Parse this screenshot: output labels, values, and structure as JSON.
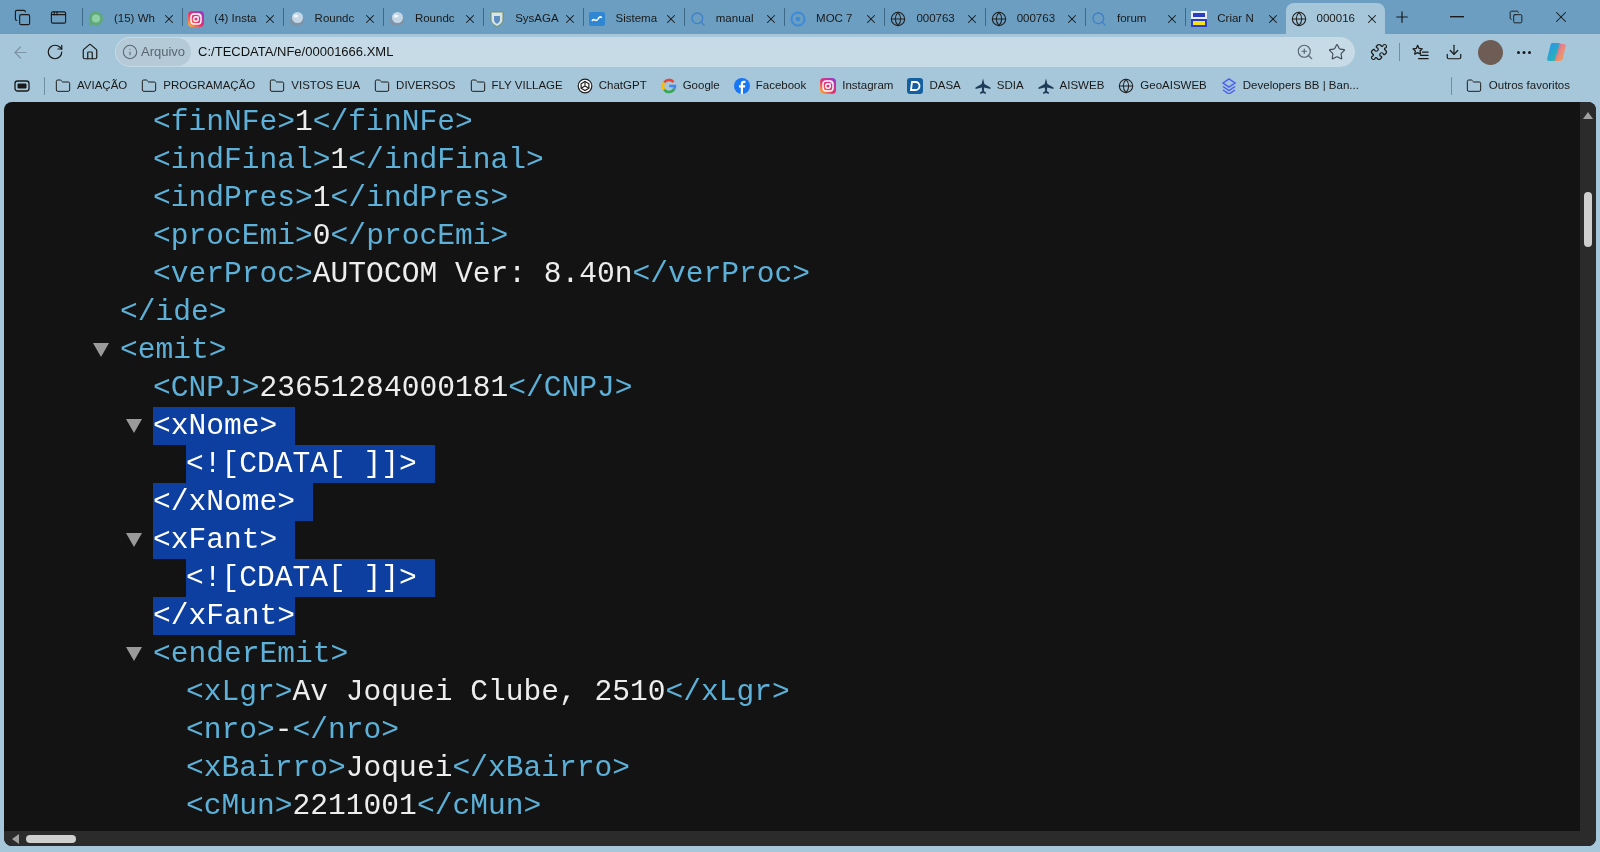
{
  "tabs": [
    {
      "title": "(15) Wh",
      "kind": "chat",
      "selected": false
    },
    {
      "title": "(4) Insta",
      "kind": "camera",
      "selected": false
    },
    {
      "title": "Roundc",
      "kind": "sphere",
      "selected": false
    },
    {
      "title": "Roundc",
      "kind": "sphere",
      "selected": false
    },
    {
      "title": "SysAGA",
      "kind": "crest",
      "selected": false
    },
    {
      "title": "Sistema",
      "kind": "tile",
      "selected": false
    },
    {
      "title": "manual",
      "kind": "search",
      "selected": false
    },
    {
      "title": "MOC 7",
      "kind": "ring",
      "selected": false
    },
    {
      "title": "000763",
      "kind": "globe",
      "selected": false
    },
    {
      "title": "000763",
      "kind": "globe",
      "selected": false
    },
    {
      "title": "forum",
      "kind": "search",
      "selected": false
    },
    {
      "title": "Criar N",
      "kind": "split",
      "selected": false
    },
    {
      "title": "000016",
      "kind": "globe",
      "selected": true
    }
  ],
  "navigation": {
    "back_disabled": true
  },
  "address_bar": {
    "site_label": "Arquivo",
    "url": "C:/TECDATA/NFe/00001666.XML"
  },
  "bookmarks": [
    {
      "label": "AVIAÇÃO",
      "kind": "folder"
    },
    {
      "label": "PROGRAMAÇÃO",
      "kind": "folder"
    },
    {
      "label": "VISTOS EUA",
      "kind": "folder"
    },
    {
      "label": "DIVERSOS",
      "kind": "folder"
    },
    {
      "label": "FLY VILLAGE",
      "kind": "folder"
    },
    {
      "label": "ChatGPT",
      "kind": "knot"
    },
    {
      "label": "Google",
      "kind": "google"
    },
    {
      "label": "Facebook",
      "kind": "facebook"
    },
    {
      "label": "Instagram",
      "kind": "camera"
    },
    {
      "label": "DASA",
      "kind": "tile"
    },
    {
      "label": "SDIA",
      "kind": "plane"
    },
    {
      "label": "AISWEB",
      "kind": "plane"
    },
    {
      "label": "GeoAISWEB",
      "kind": "globe"
    },
    {
      "label": "Developers BB | Ban...",
      "kind": "layers"
    }
  ],
  "other_favorites": {
    "label": "Outros favoritos"
  },
  "xml_view": {
    "nodes": [
      {
        "kind": "tail",
        "selected": false,
        "close": "</ide>",
        "children": [
          {
            "kind": "element",
            "selected": false,
            "open": "<finNFe>",
            "value": "1",
            "close": "</finNFe>"
          },
          {
            "kind": "element",
            "selected": false,
            "open": "<indFinal>",
            "value": "1",
            "close": "</indFinal>"
          },
          {
            "kind": "element",
            "selected": false,
            "open": "<indPres>",
            "value": "1",
            "close": "</indPres>"
          },
          {
            "kind": "element",
            "selected": false,
            "open": "<procEmi>",
            "value": "0",
            "close": "</procEmi>"
          },
          {
            "kind": "element",
            "selected": false,
            "open": "<verProc>",
            "value": "AUTOCOM Ver: 8.40n",
            "close": "</verProc>"
          }
        ]
      },
      {
        "kind": "group",
        "expanded": true,
        "selected": false,
        "open": "<emit>",
        "children": [
          {
            "kind": "element",
            "selected": false,
            "open": "<CNPJ>",
            "value": "23651284000181",
            "close": "</CNPJ>"
          },
          {
            "kind": "group",
            "expanded": true,
            "selected": true,
            "open": "<xNome>",
            "children": [
              {
                "kind": "text",
                "selected": true,
                "text": "<![CDATA[ ]]>"
              }
            ],
            "close": "</xNome>"
          },
          {
            "kind": "group",
            "expanded": true,
            "selected": true,
            "open": "<xFant>",
            "children": [
              {
                "kind": "text",
                "selected": true,
                "text": "<![CDATA[ ]]>"
              }
            ],
            "close": "</xFant>"
          },
          {
            "kind": "group",
            "expanded": true,
            "selected": false,
            "open": "<enderEmit>",
            "children": [
              {
                "kind": "element",
                "selected": false,
                "open": "<xLgr>",
                "value": "Av Joquei Clube, 2510",
                "close": "</xLgr>"
              },
              {
                "kind": "element",
                "selected": false,
                "open": "<nro>",
                "value": "-",
                "close": "</nro>"
              },
              {
                "kind": "element",
                "selected": false,
                "open": "<xBairro>",
                "value": "Joquei",
                "close": "</xBairro>"
              },
              {
                "kind": "element",
                "selected": false,
                "open": "<cMun>",
                "value": "2211001",
                "close": "</cMun>"
              }
            ]
          }
        ]
      }
    ]
  }
}
